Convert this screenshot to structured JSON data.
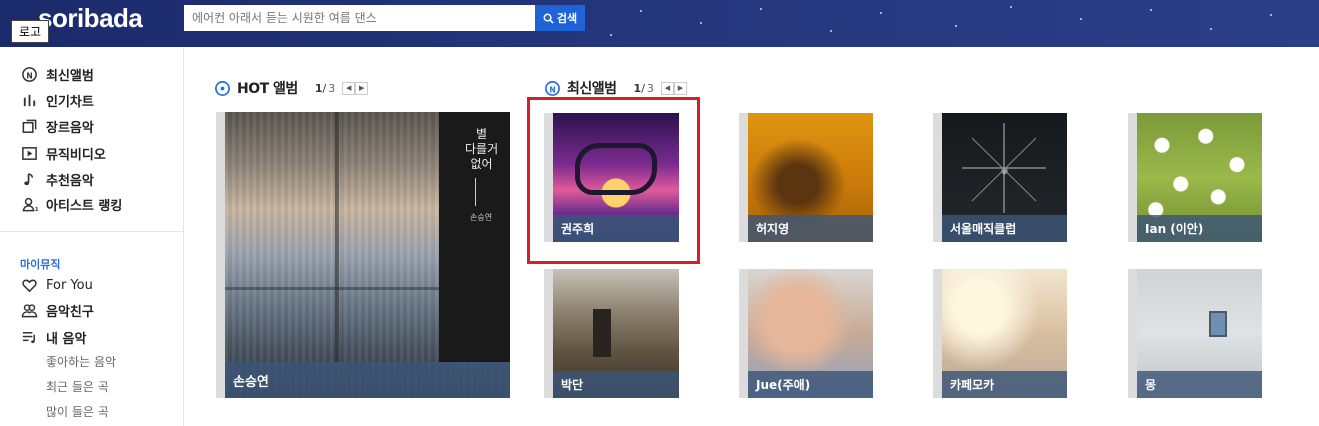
{
  "header": {
    "logo": "soribada",
    "logo_label": "로고",
    "search_placeholder": "에어컨 아래서 듣는 시원한 여름 댄스",
    "search_button": "검색"
  },
  "sidebar": {
    "items": [
      {
        "label": "최신앨범",
        "icon": "new-album-icon"
      },
      {
        "label": "인기차트",
        "icon": "chart-icon"
      },
      {
        "label": "장르음악",
        "icon": "genre-icon"
      },
      {
        "label": "뮤직비디오",
        "icon": "video-icon"
      },
      {
        "label": "추천음악",
        "icon": "music-note-icon"
      },
      {
        "label": "아티스트 랭킹",
        "icon": "artist-icon"
      }
    ],
    "mymusic_label": "마이뮤직",
    "mymusic_items": [
      {
        "label": "For You",
        "icon": "heart-icon"
      },
      {
        "label": "음악친구",
        "icon": "friends-icon"
      },
      {
        "label": "내 음악",
        "icon": "playlist-icon"
      }
    ],
    "sub_items": [
      "좋아하는 음악",
      "최근 들은 곡",
      "많이 들은 곡"
    ]
  },
  "hot": {
    "title": "HOT 앨범",
    "page_current": "1",
    "page_total": "3",
    "album": {
      "artist": "손승연",
      "cover_title_line1": "별",
      "cover_title_line2": "다를거",
      "cover_title_line3": "없어",
      "cover_author": "손승연"
    }
  },
  "latest": {
    "title": "최신앨범",
    "page_current": "1",
    "page_total": "3",
    "albums": [
      {
        "artist": "권주희"
      },
      {
        "artist": "허지영"
      },
      {
        "artist": "서울매직클럽"
      },
      {
        "artist": "Ian (이안)"
      },
      {
        "artist": "박단"
      },
      {
        "artist": "Jue(주애)"
      },
      {
        "artist": "카페모카"
      },
      {
        "artist": "몽"
      }
    ]
  },
  "colors": {
    "header_bg": "#23347a",
    "accent_blue": "#1f63d6",
    "highlight_red": "#d4202a",
    "name_bar": "#3c5578"
  }
}
